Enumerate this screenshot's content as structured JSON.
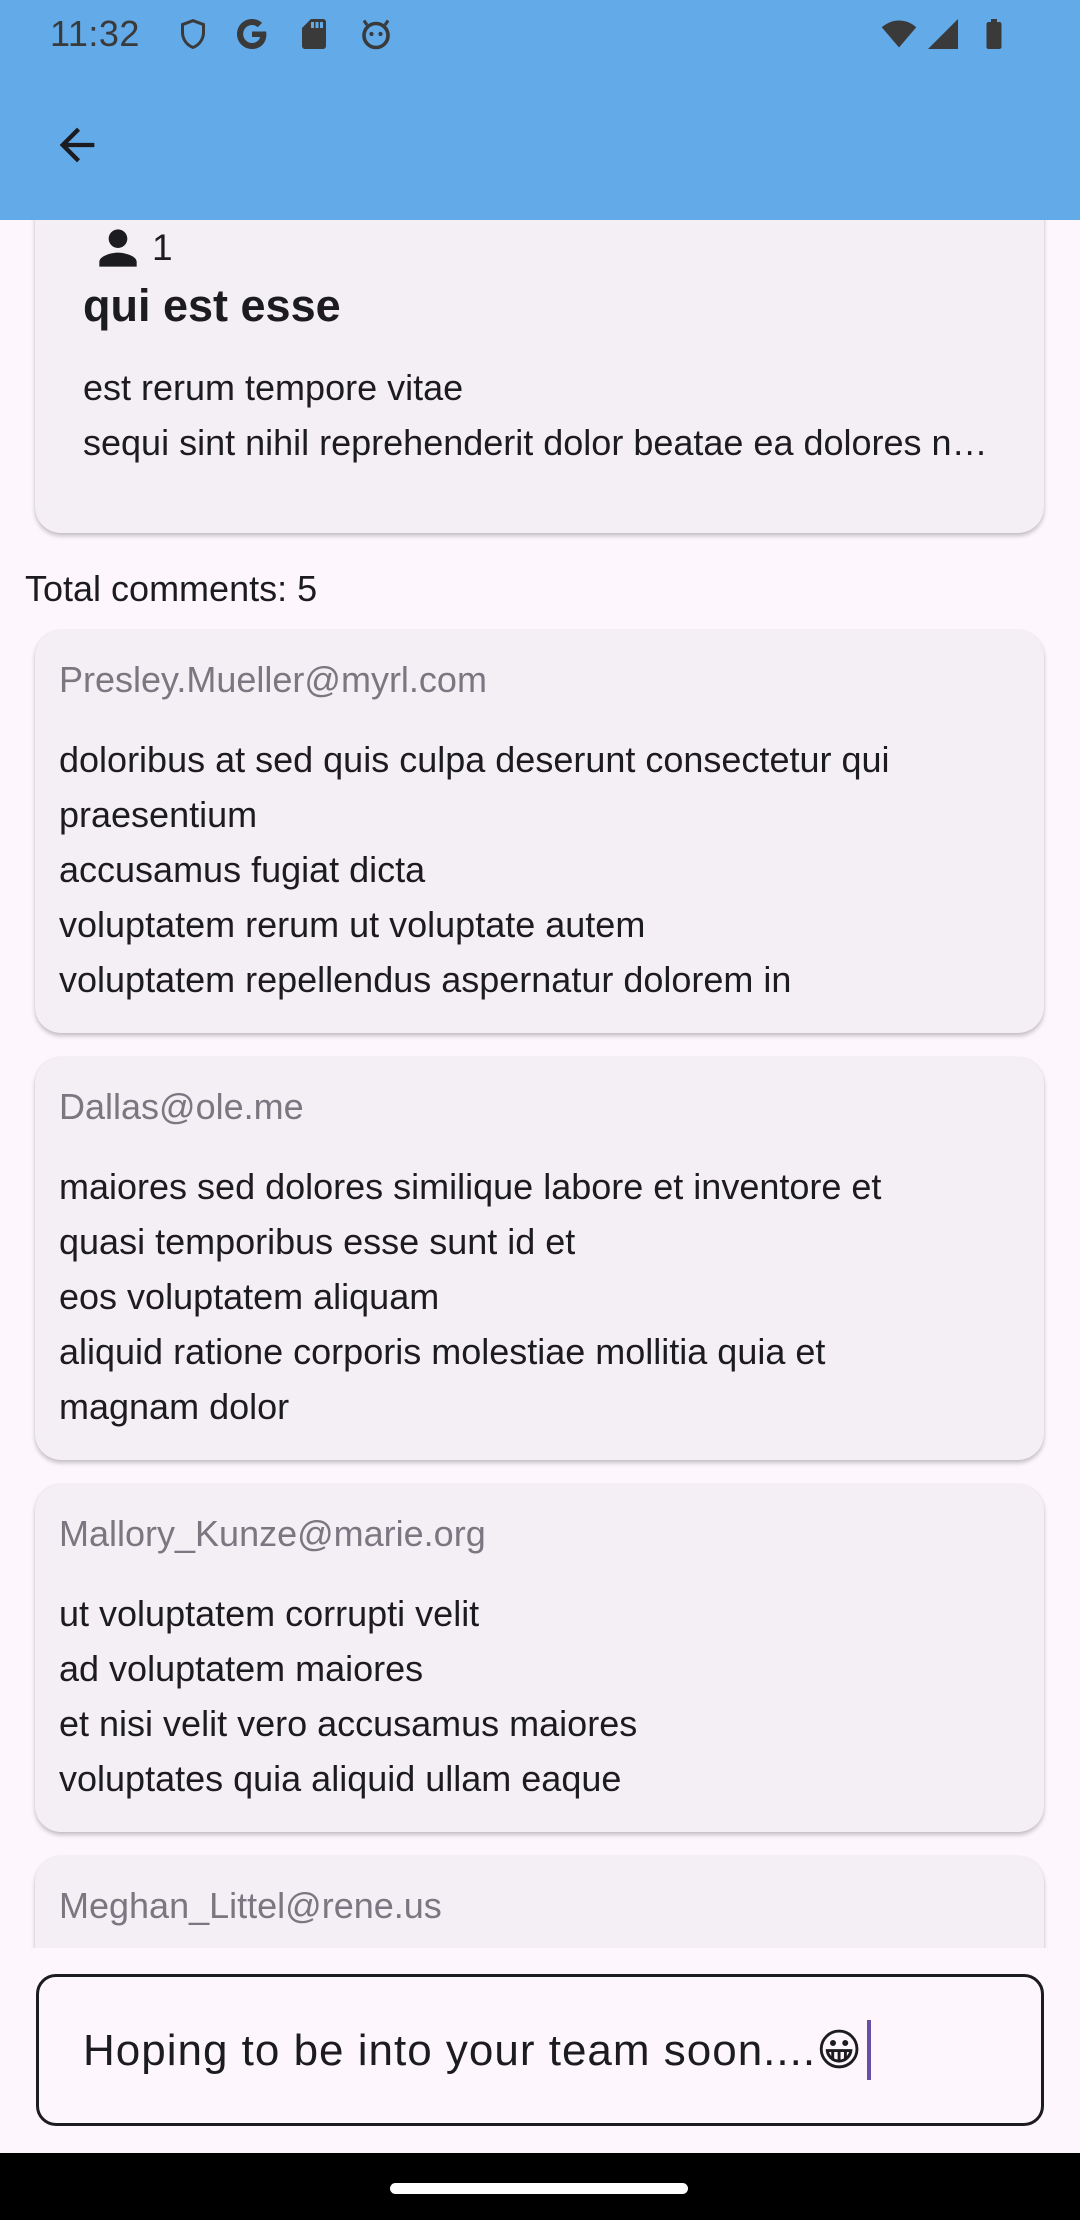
{
  "status_bar": {
    "time": "11:32",
    "left_icons": [
      "shield-icon",
      "google-icon",
      "sd-card-icon",
      "debug-icon"
    ],
    "right_icons": [
      "wifi-icon",
      "signal-icon",
      "battery-icon"
    ]
  },
  "app_bar": {
    "back_icon": "arrow-back-icon",
    "color": "#62aae8"
  },
  "post": {
    "user_icon": "person-icon",
    "user_id": "1",
    "title": "qui est esse",
    "body_line1": "est rerum tempore vitae",
    "body_line2": "sequi sint nihil reprehenderit dolor beatae ea dolores neque"
  },
  "comments_summary": "Total comments: 5",
  "comments": [
    {
      "email": "Presley.Mueller@myrl.com",
      "lines": [
        "doloribus at sed quis culpa deserunt consectetur qui",
        "praesentium",
        "accusamus fugiat dicta",
        "voluptatem rerum ut voluptate autem",
        "voluptatem repellendus aspernatur dolorem in"
      ]
    },
    {
      "email": "Dallas@ole.me",
      "lines": [
        "maiores sed dolores similique labore et inventore et",
        "quasi temporibus esse sunt id et",
        "eos voluptatem aliquam",
        "aliquid ratione corporis molestiae mollitia quia et",
        "magnam dolor"
      ]
    },
    {
      "email": "Mallory_Kunze@marie.org",
      "lines": [
        "ut voluptatem corrupti velit",
        "ad voluptatem maiores",
        "et nisi velit vero accusamus maiores",
        "voluptates quia aliquid ullam eaque"
      ]
    },
    {
      "email": "Meghan_Littel@rene.us",
      "lines": []
    }
  ],
  "input": {
    "value": "Hoping to be into your team soon....😀"
  }
}
